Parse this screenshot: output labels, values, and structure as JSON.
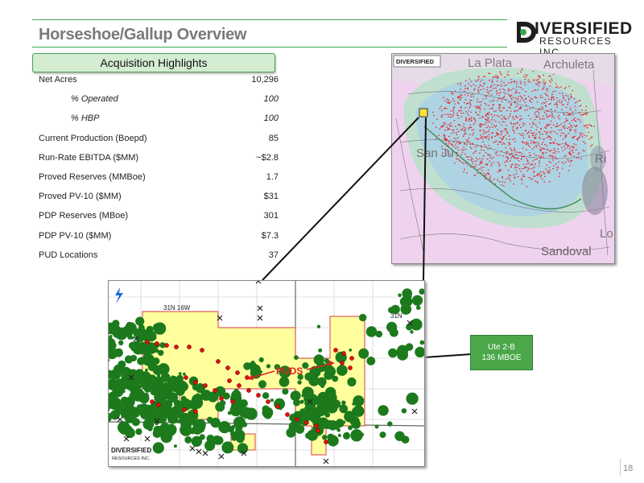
{
  "slide": {
    "title": "Horseshoe/Gallup Overview",
    "page_number": "18"
  },
  "logo": {
    "main": "IVERSIFIED",
    "sub": "RESOURCES INC."
  },
  "highlights": {
    "header": "Acquisition Highlights",
    "rows": [
      {
        "label": "Net Acres",
        "value": "10,296",
        "sub": false
      },
      {
        "label": "% Operated",
        "value": "100",
        "sub": true
      },
      {
        "label": "% HBP",
        "value": "100",
        "sub": true
      },
      {
        "label": "Current Production (Boepd)",
        "value": "85",
        "sub": false
      },
      {
        "label": "Run-Rate EBITDA ($MM)",
        "value": "~$2.8",
        "sub": false
      },
      {
        "label": "Proved Reserves (MMBoe)",
        "value": "1.7",
        "sub": false
      },
      {
        "label": "Proved PV-10 ($MM)",
        "value": "$31",
        "sub": false
      },
      {
        "label": "PDP Reserves (MBoe)",
        "value": "301",
        "sub": false
      },
      {
        "label": "PDP PV-10 ($MM)",
        "value": "$7.3",
        "sub": false
      },
      {
        "label": "PUD Locations",
        "value": "37",
        "sub": false
      }
    ]
  },
  "top_map": {
    "logo_text": "DIVERSIFIED",
    "labels": {
      "la_plata": "La Plata",
      "archuleta": "Archuleta",
      "san_juan": "San Ju",
      "rio": "Ri",
      "sandoval": "Sandoval",
      "lo": "Lo"
    }
  },
  "bottom_map": {
    "township": "31N 16W",
    "township_right": "31N",
    "puds_label": "PUDS",
    "logo_text": "DIVERSIFIED",
    "logo_sub": "RESOURCES INC."
  },
  "callout": {
    "line1": "Ute 2-B",
    "line2": "136 MBOE"
  },
  "colors": {
    "accent_green": "#3aa84a",
    "lease_yellow": "#ffff9e",
    "well_green": "#1c7a1c",
    "pud_red": "#d11",
    "callout_green": "#4aa84a"
  }
}
